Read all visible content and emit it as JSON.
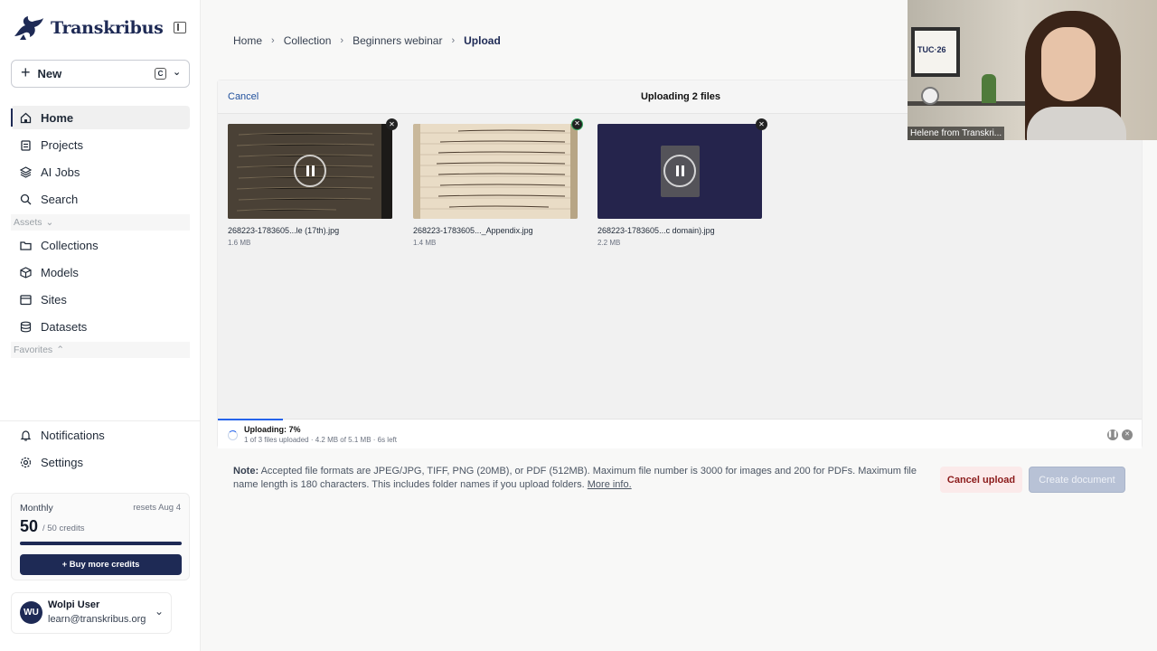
{
  "brand": {
    "name": "Transkribus",
    "color": "#1e2a55"
  },
  "sidebar": {
    "new_label": "New",
    "new_shortcut": "C",
    "nav": [
      {
        "label": "Home",
        "icon": "home-icon",
        "active": true
      },
      {
        "label": "Projects",
        "icon": "clipboard-icon"
      },
      {
        "label": "AI Jobs",
        "icon": "layers-icon"
      },
      {
        "label": "Search",
        "icon": "search-icon"
      }
    ],
    "assets_label": "Assets",
    "assets": [
      {
        "label": "Collections",
        "icon": "folder-icon"
      },
      {
        "label": "Models",
        "icon": "cube-icon"
      },
      {
        "label": "Sites",
        "icon": "browser-window-icon"
      },
      {
        "label": "Datasets",
        "icon": "database-icon"
      }
    ],
    "favorites_label": "Favorites",
    "bottom": [
      {
        "label": "Notifications",
        "icon": "bell-icon"
      },
      {
        "label": "Settings",
        "icon": "gear-icon"
      }
    ],
    "credits": {
      "period": "Monthly",
      "reset": "resets Aug 4",
      "remaining": "50",
      "total": "/ 50 credits",
      "fraction_remaining": 1.0,
      "buy_label": "+ Buy more credits"
    },
    "user": {
      "initials": "WU",
      "name": "Wolpi User",
      "email": "learn@transkribus.org"
    }
  },
  "breadcrumb": [
    "Home",
    "Collection",
    "Beginners webinar",
    "Upload"
  ],
  "upload": {
    "cancel_label": "Cancel",
    "title": "Uploading 2 files",
    "files": [
      {
        "name": "268223-1783605...le (17th).jpg",
        "size": "1.6 MB",
        "state": "paused"
      },
      {
        "name": "268223-1783605..._Appendix.jpg",
        "size": "1.4 MB",
        "state": "done"
      },
      {
        "name": "268223-1783605...c domain).jpg",
        "size": "2.2 MB",
        "state": "paused"
      }
    ],
    "status_title": "Uploading: 7%",
    "status_sub": "1 of 3 files uploaded · 4.2 MB of 5.1 MB · 6s left",
    "progress": 0.07
  },
  "note": {
    "label": "Note:",
    "text": "Accepted file formats are JPEG/JPG, TIFF, PNG (20MB), or PDF (512MB). Maximum file number is 3000 for images and 200 for PDFs. Maximum file name length is 180 characters. This includes folder names if you upload folders.",
    "more_link": "More info."
  },
  "actions": {
    "cancel_upload": "Cancel upload",
    "create_document": "Create document"
  },
  "video": {
    "label": "Helene from Transkri...",
    "poster_text": "TUC·26"
  }
}
